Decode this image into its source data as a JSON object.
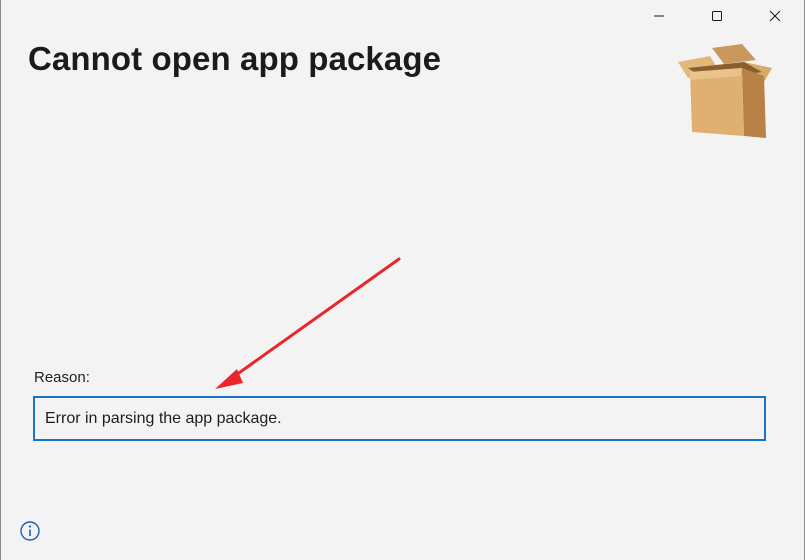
{
  "window": {
    "controls": {
      "minimize_icon": "minimize-icon",
      "maximize_icon": "maximize-icon",
      "close_icon": "close-icon"
    }
  },
  "header": {
    "title": "Cannot open app package",
    "icon": "package-box-icon"
  },
  "reason": {
    "label": "Reason:",
    "value": "Error in parsing the app package."
  },
  "footer": {
    "info_icon": "info-icon"
  },
  "colors": {
    "background": "#f3f3f3",
    "focus_border": "#1a73c9",
    "annotation_arrow": "#e8262b"
  }
}
